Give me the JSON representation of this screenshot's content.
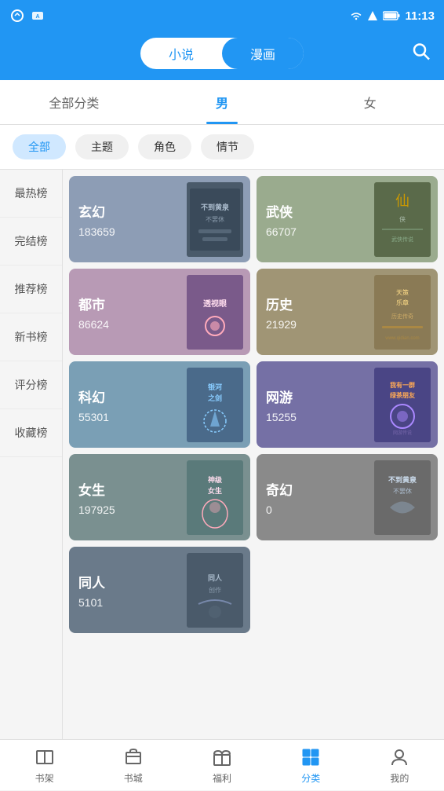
{
  "statusBar": {
    "time": "11:13",
    "battery": "100"
  },
  "header": {
    "tabs": [
      {
        "id": "novel",
        "label": "小说",
        "active": false
      },
      {
        "id": "manga",
        "label": "漫画",
        "active": true
      }
    ],
    "searchLabel": "搜索"
  },
  "categoryNav": {
    "items": [
      {
        "id": "all",
        "label": "全部分类",
        "active": false
      },
      {
        "id": "male",
        "label": "男",
        "active": true
      },
      {
        "id": "female",
        "label": "女",
        "active": false
      }
    ]
  },
  "filterTags": [
    {
      "id": "all",
      "label": "全部",
      "active": true
    },
    {
      "id": "theme",
      "label": "主题",
      "active": false
    },
    {
      "id": "role",
      "label": "角色",
      "active": false
    },
    {
      "id": "plot",
      "label": "情节",
      "active": false
    }
  ],
  "sidebar": {
    "items": [
      {
        "id": "hot",
        "label": "最热榜"
      },
      {
        "id": "finished",
        "label": "完结榜"
      },
      {
        "id": "recommend",
        "label": "推荐榜"
      },
      {
        "id": "newbook",
        "label": "新书榜"
      },
      {
        "id": "rating",
        "label": "评分榜"
      },
      {
        "id": "collection",
        "label": "收藏榜"
      }
    ]
  },
  "grid": {
    "rows": [
      [
        {
          "id": "xuanhuan",
          "title": "玄幻",
          "count": "183659",
          "colorClass": "card-xuanhuan"
        },
        {
          "id": "wuxia",
          "title": "武侠",
          "count": "66707",
          "colorClass": "card-wuxia"
        }
      ],
      [
        {
          "id": "dushi",
          "title": "都市",
          "count": "86624",
          "colorClass": "card-dushi"
        },
        {
          "id": "lishi",
          "title": "历史",
          "count": "21929",
          "colorClass": "card-lishi"
        }
      ],
      [
        {
          "id": "kehuan",
          "title": "科幻",
          "count": "55301",
          "colorClass": "card-kehuan"
        },
        {
          "id": "wangyou",
          "title": "网游",
          "count": "15255",
          "colorClass": "card-wangyou"
        }
      ],
      [
        {
          "id": "nvsheng",
          "title": "女生",
          "count": "197925",
          "colorClass": "card-nvsheng"
        },
        {
          "id": "qihuan",
          "title": "奇幻",
          "count": "0",
          "colorClass": "card-qihuan"
        }
      ],
      [
        {
          "id": "tongren",
          "title": "同人",
          "count": "5101",
          "colorClass": "card-tongren"
        }
      ]
    ]
  },
  "bottomNav": {
    "items": [
      {
        "id": "shelf",
        "label": "书架",
        "active": false
      },
      {
        "id": "store",
        "label": "书城",
        "active": false
      },
      {
        "id": "welfare",
        "label": "福利",
        "active": false
      },
      {
        "id": "category",
        "label": "分类",
        "active": true
      },
      {
        "id": "mine",
        "label": "我的",
        "active": false
      }
    ]
  }
}
